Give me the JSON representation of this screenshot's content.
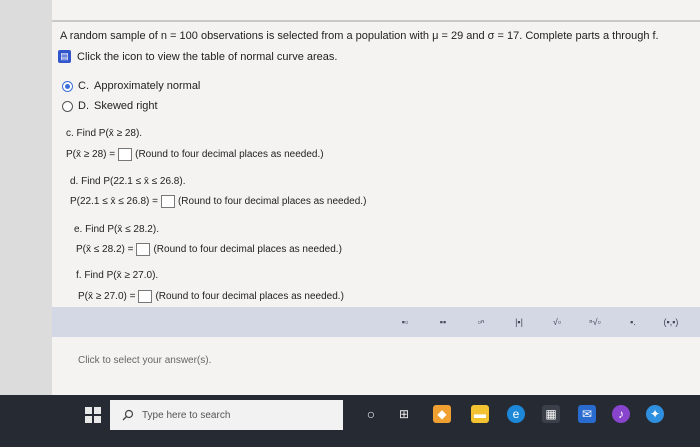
{
  "question": {
    "text": "A random sample of n = 100 observations is selected from a population with μ = 29 and σ = 17. Complete parts a through f.",
    "table_link": "Click the icon to view the table of normal curve areas."
  },
  "options": [
    {
      "label": "C.",
      "text": "Approximately normal",
      "selected": true
    },
    {
      "label": "D.",
      "text": "Skewed right",
      "selected": false
    }
  ],
  "parts": [
    {
      "title": "c. Find P(x̄ ≥ 28).",
      "expr": "P(x̄ ≥ 28) =",
      "hint": "(Round to four decimal places as needed.)"
    },
    {
      "title": "d. Find P(22.1 ≤ x̄ ≤ 26.8).",
      "expr": "P(22.1 ≤ x̄ ≤ 26.8) =",
      "hint": "(Round to four decimal places as needed.)"
    },
    {
      "title": "e. Find P(x̄ ≤ 28.2).",
      "expr": "P(x̄ ≤ 28.2) =",
      "hint": "(Round to four decimal places as needed.)"
    },
    {
      "title": "f. Find P(x̄ ≥ 27.0).",
      "expr": "P(x̄ ≥ 27.0) =",
      "hint": "(Round to four decimal places as needed.)"
    }
  ],
  "toolbar": {
    "tools": [
      "▪▫",
      "▪▪",
      "▫ⁿ",
      "|▪|",
      "√▫",
      "ⁿ√▫",
      "▪.",
      "(▪,▪)"
    ]
  },
  "status": "Click to select your answer(s).",
  "taskbar": {
    "search_placeholder": "Type here to search"
  }
}
